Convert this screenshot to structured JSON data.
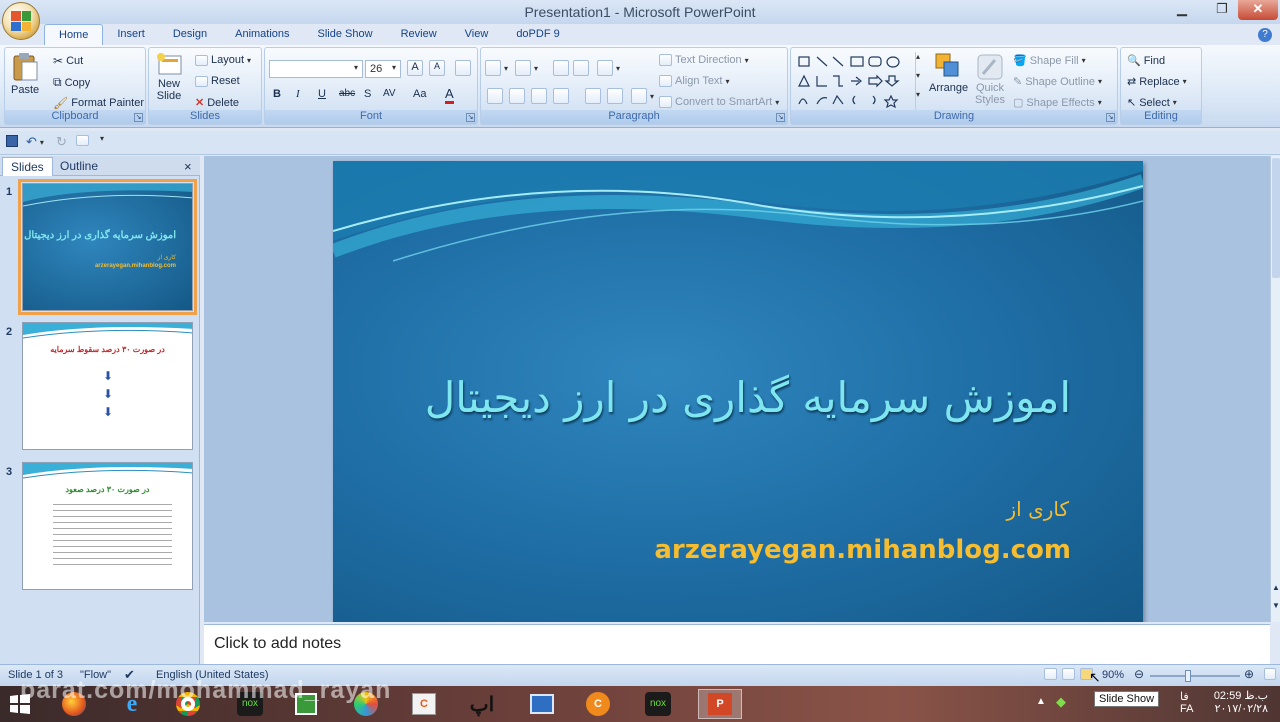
{
  "window": {
    "title": "Presentation1 - Microsoft PowerPoint",
    "minimize": "▁",
    "restore": "❐",
    "close": "✕"
  },
  "tabs": [
    "Home",
    "Insert",
    "Design",
    "Animations",
    "Slide Show",
    "Review",
    "View",
    "doPDF 9"
  ],
  "ribbon": {
    "clipboard": {
      "label": "Clipboard",
      "paste": "Paste",
      "cut": "Cut",
      "copy": "Copy",
      "format_painter": "Format Painter"
    },
    "slides": {
      "label": "Slides",
      "new_slide": "New",
      "new_slide2": "Slide",
      "layout": "Layout",
      "reset": "Reset",
      "delete": "Delete"
    },
    "font": {
      "label": "Font",
      "font_name": "",
      "font_size": "26",
      "bold": "B",
      "italic": "I",
      "underline": "U",
      "strike": "abc",
      "shadow": "S",
      "spacing": "AV",
      "case": "Aa",
      "color": "A",
      "grow": "A",
      "shrink": "A"
    },
    "paragraph": {
      "label": "Paragraph",
      "text_direction": "Text Direction",
      "align_text": "Align Text",
      "convert_smartart": "Convert to SmartArt"
    },
    "drawing": {
      "label": "Drawing",
      "arrange": "Arrange",
      "quick_styles": "Quick",
      "quick_styles2": "Styles",
      "shape_fill": "Shape Fill",
      "shape_outline": "Shape Outline",
      "shape_effects": "Shape Effects"
    },
    "editing": {
      "label": "Editing",
      "find": "Find",
      "replace": "Replace",
      "select": "Select"
    }
  },
  "pane": {
    "slides_tab": "Slides",
    "outline_tab": "Outline",
    "close": "×"
  },
  "thumbnails": [
    {
      "num": "1",
      "title": "اموزش سرمایه گذاری در ارز دیجیتال",
      "sub1": "کاری از",
      "sub2": "arzerayegan.mihanblog.com"
    },
    {
      "num": "2",
      "title": "در صورت ۳۰ درصد سقوط سرمایه"
    },
    {
      "num": "3",
      "title": "در صورت ۳۰ درصد صعود"
    }
  ],
  "slide": {
    "title": "اموزش سرمایه گذاری در ارز دیجیتال",
    "subtitle1": "کاری از",
    "subtitle2": "arzerayegan.mihanblog.com"
  },
  "notes": {
    "placeholder": "Click to add notes"
  },
  "status": {
    "slide_count": "Slide 1 of 3",
    "theme": "\"Flow\"",
    "language": "English (United States)",
    "zoom": "90%"
  },
  "tooltip": "Slide Show",
  "watermark": "parat.com/mohammad_rayan",
  "taskbar": {
    "time": "02:59 ب.ظ",
    "date": "۲۰۱۷/۰۲/۲۸",
    "lang": "FA",
    "lang2": "فا"
  },
  "colors": {
    "slide_bg": "#1f6ea6",
    "title_color": "#7fe6f0",
    "subtitle_color": "#f5bd2f",
    "ribbon_bg": "#dde9f7"
  }
}
